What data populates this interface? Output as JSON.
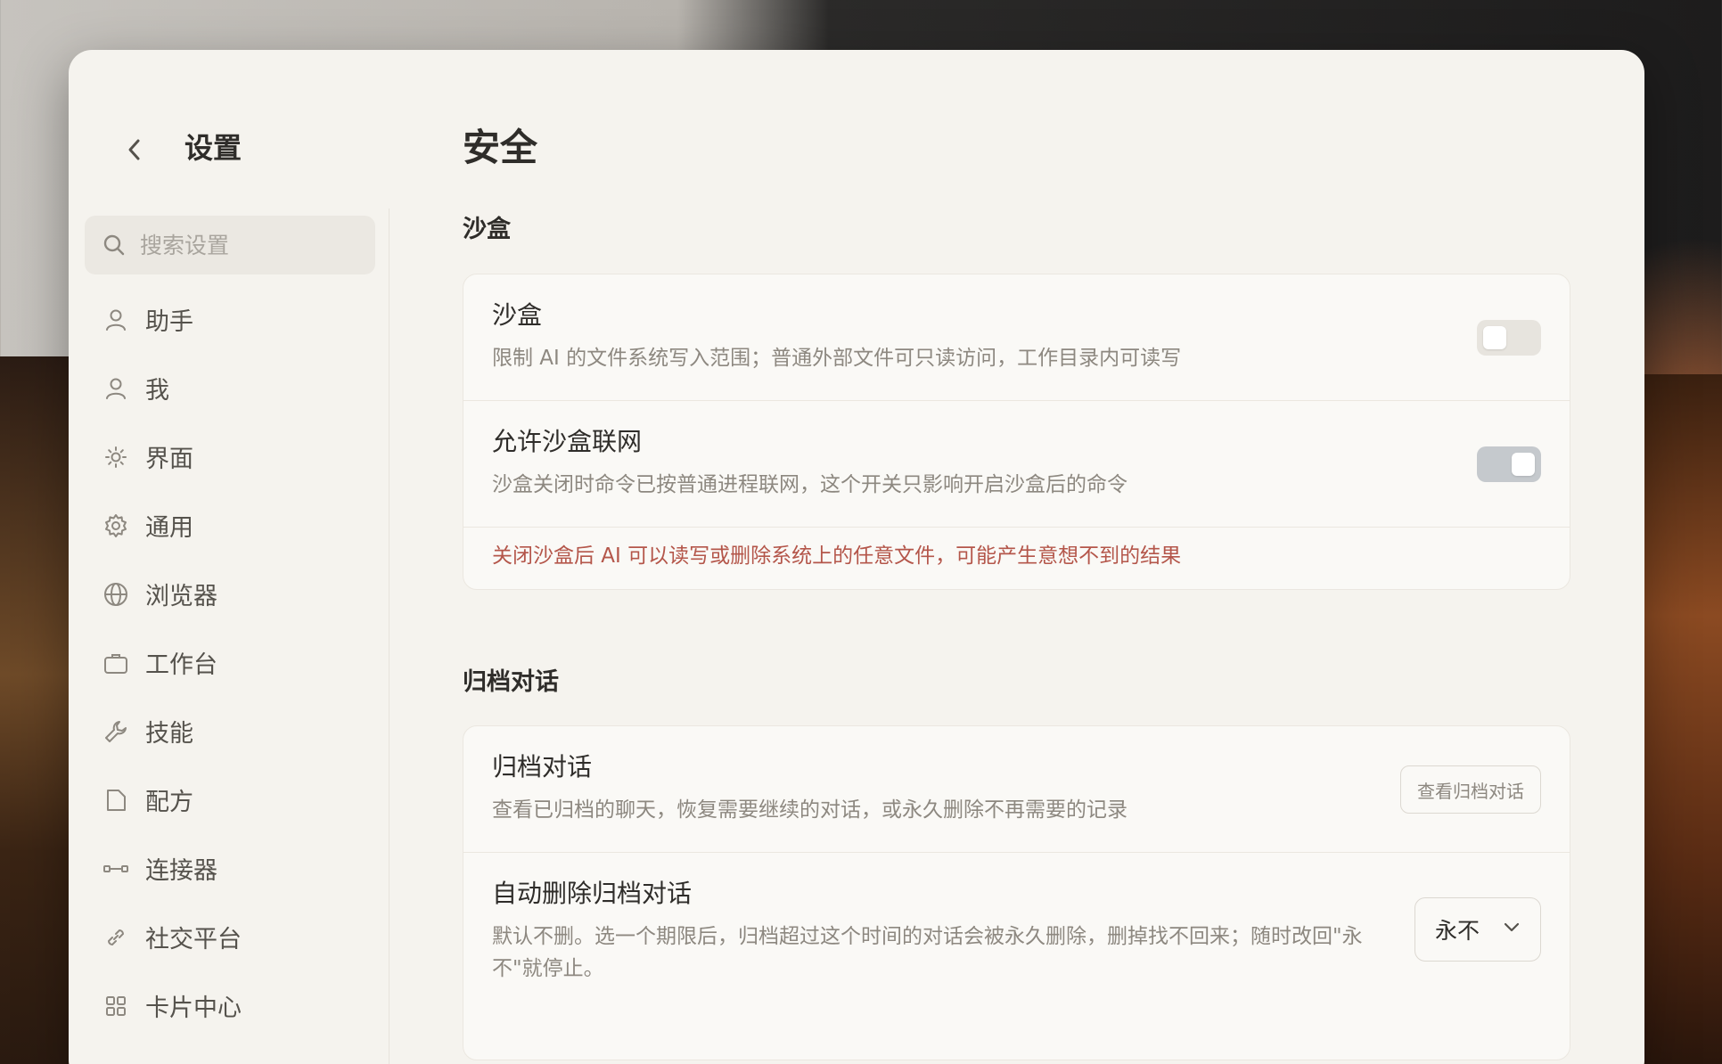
{
  "sidebar": {
    "title": "设置",
    "search_placeholder": "搜索设置",
    "items": [
      {
        "label": "助手",
        "icon": "person-icon"
      },
      {
        "label": "我",
        "icon": "person-icon"
      },
      {
        "label": "界面",
        "icon": "sun-icon"
      },
      {
        "label": "通用",
        "icon": "gear-icon"
      },
      {
        "label": "浏览器",
        "icon": "globe-icon"
      },
      {
        "label": "工作台",
        "icon": "briefcase-icon"
      },
      {
        "label": "技能",
        "icon": "wrench-icon"
      },
      {
        "label": "配方",
        "icon": "document-icon"
      },
      {
        "label": "连接器",
        "icon": "connector-icon"
      },
      {
        "label": "社交平台",
        "icon": "link-icon"
      },
      {
        "label": "卡片中心",
        "icon": "grid-icon"
      }
    ]
  },
  "main": {
    "title": "安全",
    "sandbox_section": {
      "heading": "沙盒",
      "sandbox": {
        "title": "沙盒",
        "description": "限制 AI 的文件系统写入范围；普通外部文件可只读访问，工作目录内可读写",
        "enabled": false
      },
      "network": {
        "title": "允许沙盒联网",
        "description": "沙盒关闭时命令已按普通进程联网，这个开关只影响开启沙盒后的命令",
        "enabled": true
      },
      "warning": "关闭沙盒后 AI 可以读写或删除系统上的任意文件，可能产生意想不到的结果"
    },
    "archive_section": {
      "heading": "归档对话",
      "archived": {
        "title": "归档对话",
        "description": "查看已归档的聊天，恢复需要继续的对话，或永久删除不再需要的记录",
        "button": "查看归档对话"
      },
      "auto_delete": {
        "title": "自动删除归档对话",
        "description": "默认不删。选一个期限后，归档超过这个时间的对话会被永久删除，删掉找不回来；随时改回\"永不\"就停止。",
        "selected": "永不"
      }
    }
  },
  "colors": {
    "window_bg": "#f5f3ee",
    "warning": "#b4564a",
    "toggle_on": "#c5c9cd",
    "toggle_off": "#e7e4de"
  }
}
